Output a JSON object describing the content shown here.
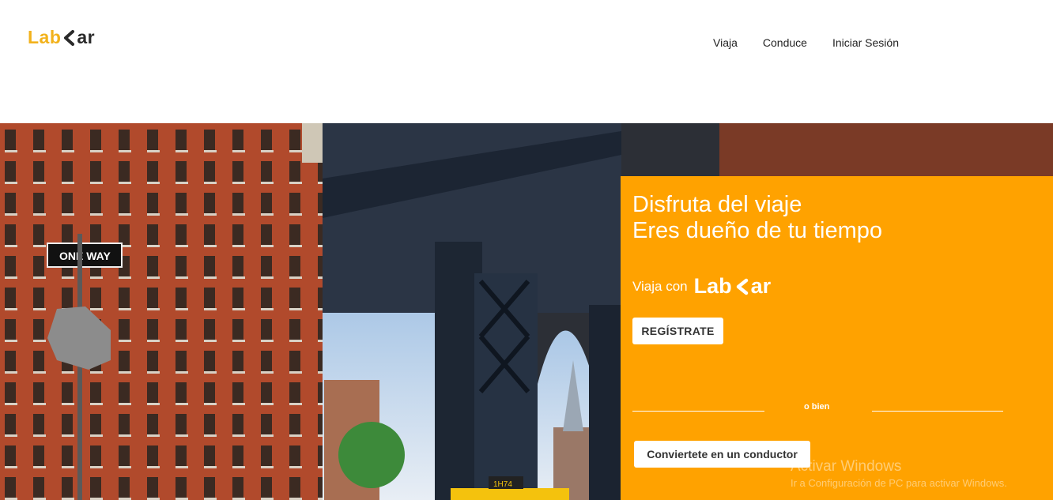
{
  "brand": {
    "left": "Lab",
    "right": "ar"
  },
  "nav": {
    "items": [
      "Viaja",
      "Conduce",
      "Iniciar Sesión"
    ]
  },
  "hero": {
    "headline_1": "Disfruta del viaje",
    "headline_2": "Eres dueño de tu tiempo",
    "ride_prefix": "Viaja con",
    "register_button": "REGÍSTRATE",
    "or_text": "o bien",
    "driver_button": "Conviertete en un conductor"
  },
  "photo": {
    "street_sign": "ONE WAY",
    "taxi_number": "1H74"
  },
  "watermark": {
    "line1": "Activar Windows",
    "line2": "Ir a Configuración de PC para activar Windows."
  },
  "colors": {
    "accent": "#ffa200",
    "logo_yellow": "#f2b21c",
    "logo_dark": "#2a2a2a"
  }
}
